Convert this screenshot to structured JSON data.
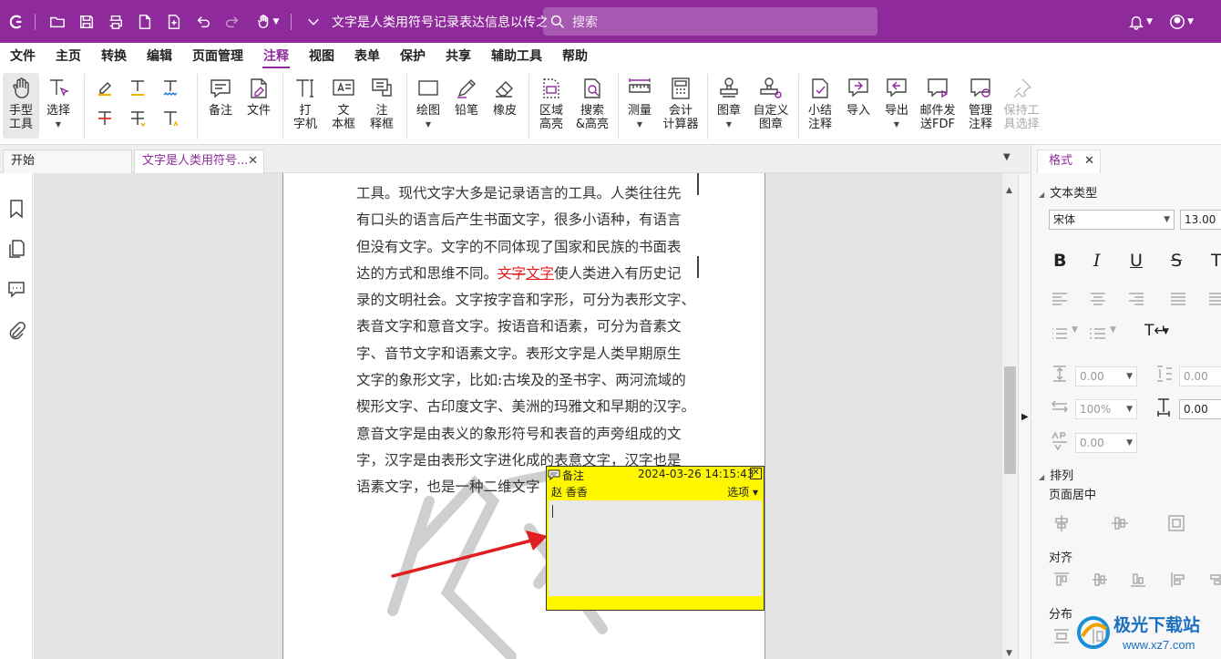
{
  "titlebar": {
    "doc_title": "文字是人类用符号记录表达信息以传之...",
    "search_placeholder": "搜索",
    "accent": "#8f2a9c"
  },
  "menu": [
    "文件",
    "主页",
    "转换",
    "编辑",
    "页面管理",
    "注释",
    "视图",
    "表单",
    "保护",
    "共享",
    "辅助工具",
    "帮助"
  ],
  "menu_active": "注释",
  "ribbon": {
    "hand": "手型\n工具",
    "select": "选择",
    "note": "备注",
    "file": "文件",
    "typewriter": "打\n字机",
    "textbox": "文\n本框",
    "callout": "注\n释框",
    "draw": "绘图",
    "pencil": "铅笔",
    "eraser": "橡皮",
    "area_highlight": "区域\n高亮",
    "search_highlight": "搜索\n&高亮",
    "measure": "测量",
    "calculator": "会计\n计算器",
    "stamp": "图章",
    "custom_stamp": "自定义\n图章",
    "summarize": "小结\n注释",
    "import": "导入",
    "export": "导出",
    "email_fdf": "邮件发\n送FDF",
    "manage": "管理\n注释",
    "keep_tool": "保持工\n具选择"
  },
  "tabs": {
    "start": "开始",
    "doc": "文字是人类用符号...",
    "close": "✕"
  },
  "document": {
    "lines": [
      "工具。现代文字大多是记录语言的工具。人类往往先",
      "有口头的语言后产生书面文字，很多小语种，有语言",
      "但没有文字。文字的不同体现了国家和民族的书面表",
      "录的文明社会。文字按字音和字形，可分为表形文字、",
      "表音文字和意音文字。按语音和语素，可分为音素文",
      "字、音节文字和语素文字。表形文字是人类早期原生",
      "文字的象形文字，比如:古埃及的圣书字、两河流域的",
      "楔形文字、古印度文字、美洲的玛雅文和早期的汉字。",
      "意音文字是由表义的象形符号和表音的声旁组成的文",
      "字，汉字是由表形文字进化成的表意文字，汉字也是",
      "语素文字，也是一种二维文字"
    ],
    "line_marked_pre": "达的方式和思维不同。",
    "line_marked_strike": "文字",
    "line_marked_under": "文字",
    "line_marked_post": "使人类进入有历史记"
  },
  "note": {
    "label": "备注",
    "datetime": "2024-03-26 14:15:43",
    "author": "赵 香香",
    "options": "选项 ▾",
    "close": "✕",
    "color": "#fff700"
  },
  "format_panel": {
    "tab": "格式",
    "text_type": "文本类型",
    "font": "宋体",
    "size": "13.00",
    "line_spacing": "0.00",
    "para_spacing": "0.00",
    "scale": "100%",
    "char_spacing": "0.00",
    "baseline": "0.00",
    "arrange": "排列",
    "page_center": "页面居中",
    "align": "对齐",
    "distribute": "分布"
  },
  "watermark_site": {
    "name": "极光下载站",
    "url": "www.xz7.com"
  }
}
